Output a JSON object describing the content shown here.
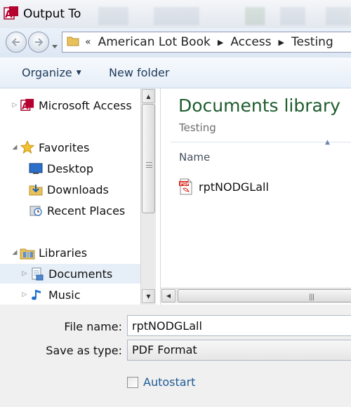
{
  "window": {
    "title": "Output To",
    "icon": "access-icon"
  },
  "address": {
    "overflow": "«",
    "parts": [
      "American Lot Book",
      "Access",
      "Testing"
    ]
  },
  "toolbar": {
    "organize_label": "Organize",
    "new_folder_label": "New folder"
  },
  "nav": {
    "items": [
      {
        "label": "Microsoft Access",
        "icon": "access-icon"
      },
      {
        "label": "Favorites",
        "icon": "star-icon"
      },
      {
        "label": "Desktop",
        "icon": "desktop-icon"
      },
      {
        "label": "Downloads",
        "icon": "downloads-folder-icon"
      },
      {
        "label": "Recent Places",
        "icon": "recent-places-icon"
      },
      {
        "label": "Libraries",
        "icon": "libraries-icon"
      },
      {
        "label": "Documents",
        "icon": "documents-icon",
        "selected": true
      },
      {
        "label": "Music",
        "icon": "music-icon"
      }
    ]
  },
  "content": {
    "library_title": "Documents library",
    "library_subtitle": "Testing",
    "column_name": "Name",
    "files": [
      {
        "name": "rptNODGLall",
        "icon": "pdf-file-icon"
      }
    ]
  },
  "form": {
    "file_name_label": "File name:",
    "file_name_value": "rptNODGLall",
    "save_type_label": "Save as type:",
    "save_type_value": "PDF Format",
    "autostart_label": "Autostart",
    "autostart_checked": false
  },
  "colors": {
    "library_title": "#1e5c2e",
    "toolbar_text": "#1e395b",
    "link_blue": "#1e5b96"
  }
}
